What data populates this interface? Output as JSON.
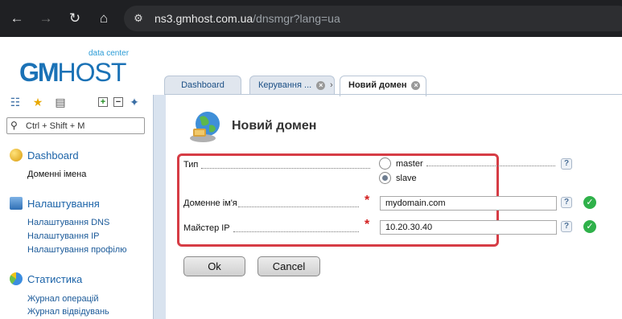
{
  "browser": {
    "back_icon": "arrow-left-icon",
    "forward_icon": "arrow-right-icon",
    "reload_icon": "reload-icon",
    "home_icon": "home-icon",
    "url_host": "ns3.gmhost.com.ua",
    "url_path": "/dnsmgr?lang=ua"
  },
  "logo": {
    "tagline": "data center",
    "brand_bold": "GM",
    "brand_rest": "HOST"
  },
  "sidebar": {
    "search_placeholder": "Ctrl + Shift + M",
    "sections": [
      {
        "title": "Dashboard",
        "items": [
          "Доменні імена"
        ]
      },
      {
        "title": "Налаштування",
        "items": [
          "Налаштування DNS",
          "Налаштування IP",
          "Налаштування профілю"
        ]
      },
      {
        "title": "Статистика",
        "items": [
          "Журнал операцій",
          "Журнал відвідувань"
        ]
      }
    ]
  },
  "tabs": [
    {
      "label": "Dashboard"
    },
    {
      "label": "Керування ..."
    },
    {
      "label": "Новий домен"
    }
  ],
  "page": {
    "title": "Новий домен"
  },
  "form": {
    "type_label": "Тип",
    "type_options": [
      "master",
      "slave"
    ],
    "type_selected": "slave",
    "domain_label": "Доменне ім'я",
    "domain_value": "mydomain.com",
    "master_ip_label": "Майстер IP",
    "master_ip_value": "10.20.30.40",
    "required_mark": "*",
    "help_mark": "?"
  },
  "buttons": {
    "ok_label": "Ok",
    "cancel_label": "Cancel"
  },
  "colors": {
    "accent_blue": "#1b72b6",
    "highlight_border": "#d63c45",
    "valid_green": "#2fb14a"
  }
}
